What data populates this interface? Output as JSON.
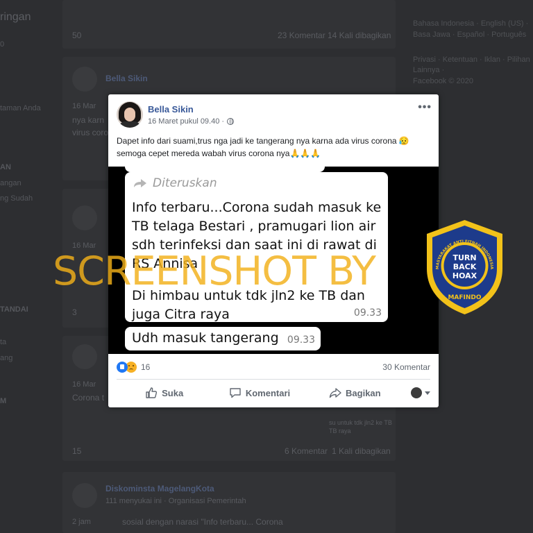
{
  "background": {
    "left_items": [
      "ringan",
      "0",
      "taman Anda",
      "AN",
      "angan",
      "ng Sudah",
      "TANDAI",
      "ta",
      "ang",
      "M"
    ],
    "posts": [
      {
        "likes": "50",
        "comments": "23 Komentar",
        "shares": "14 Kali dibagikan"
      },
      {
        "name": "Bella Sikin",
        "date": "16 Mar",
        "text1": "nya karn",
        "text2": "virus coro"
      },
      {
        "date": "16 Mar"
      },
      {
        "likes": "3"
      },
      {
        "date": "16 Mar",
        "text1": "Corona t"
      },
      {
        "likes": "15",
        "comments": "6 Komentar",
        "shares": "1 Kali dibagikan",
        "snippet1": "su untuk tdk jln2 ke TB",
        "snippet2": "TB raya"
      },
      {
        "name": "Diskominsta MagelangKota",
        "sub": "111 menyukai ini · Organisasi Pemerintah",
        "date": "2 jam",
        "text1": "sosial dengan narasi \"Info terbaru... Corona"
      }
    ],
    "right_links": [
      "Bahasa Indonesia · English (US) ·",
      "Basa Jawa · Español · Português",
      "Privasi · Ketentuan · Iklan · Pilihan",
      "Lainnya ·",
      "Facebook © 2020"
    ]
  },
  "post": {
    "author": "Bella Sikin",
    "timestamp": "16 Maret pukul 09.40 ·",
    "caption": "Dapet info dari suami,trus nga jadi ke tangerang nya karna ada virus corona 😥semoga cepet mereda wabah virus corona nya🙏🙏🙏",
    "more_label": "•••",
    "chat": {
      "forwarded_label": "Diteruskan",
      "message1": "Info terbaru...Corona sudah masuk ke TB telaga Bestari , pramugari lion air sdh terinfeksi dan saat ini di rawat di RS Annisa",
      "message2": "Di himbau untuk tdk jln2 ke TB dan juga Citra raya",
      "time1": "09.33",
      "message3": "Udh masuk tangerang",
      "time2": "09.33"
    },
    "reaction_count": "16",
    "comment_count": "30 Komentar",
    "actions": {
      "like": "Suka",
      "comment": "Komentari",
      "share": "Bagikan"
    }
  },
  "watermark": "SCREENSHOT BY",
  "badge": {
    "line1": "TURN",
    "line2": "BACK",
    "line3": "HOAX",
    "arc_text": "MASYARAKAT ANTI FITNAH INDONESIA",
    "brand": "MAFINDO"
  },
  "colors": {
    "link": "#385898",
    "watermark": "#f2b019",
    "badge_yellow": "#f2c21a",
    "badge_blue": "#1d3b8b"
  }
}
